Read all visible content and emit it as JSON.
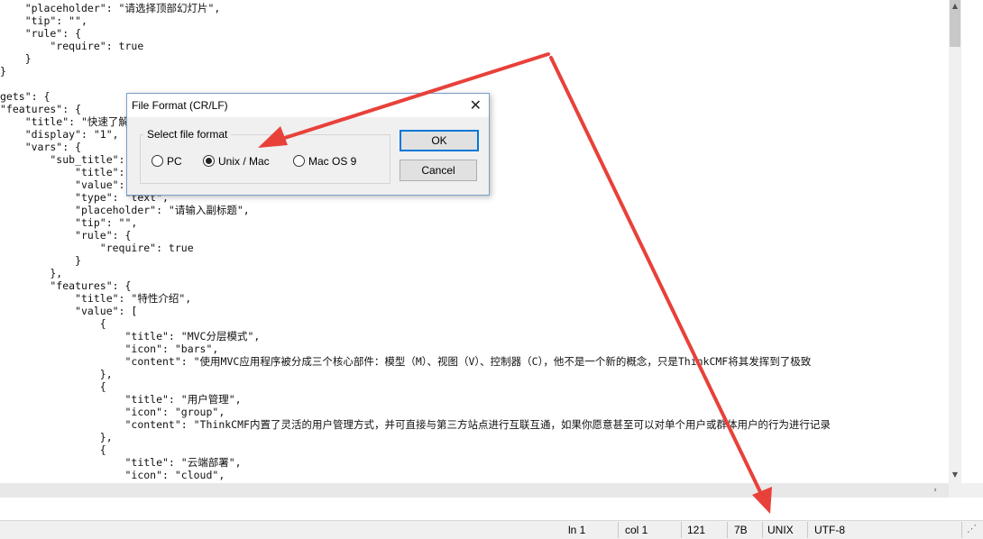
{
  "editor": {
    "lines": [
      "    \"placeholder\": \"请选择顶部幻灯片\",",
      "    \"tip\": \"\",",
      "    \"rule\": {",
      "        \"require\": true",
      "    }",
      "}",
      "",
      "gets\": {",
      "\"features\": {",
      "    \"title\": \"快速了解",
      "    \"display\": \"1\",",
      "    \"vars\": {",
      "        \"sub_title\": {",
      "            \"title\":",
      "            \"value\":",
      "            \"type\": \"text\",",
      "            \"placeholder\": \"请输入副标题\",",
      "            \"tip\": \"\",",
      "            \"rule\": {",
      "                \"require\": true",
      "            }",
      "        },",
      "        \"features\": {",
      "            \"title\": \"特性介绍\",",
      "            \"value\": [",
      "                {",
      "                    \"title\": \"MVC分层模式\",",
      "                    \"icon\": \"bars\",",
      "                    \"content\": \"使用MVC应用程序被分成三个核心部件：模型（M）、视图（V）、控制器（C），他不是一个新的概念，只是ThinkCMF将其发挥到了极致",
      "                },",
      "                {",
      "                    \"title\": \"用户管理\",",
      "                    \"icon\": \"group\",",
      "                    \"content\": \"ThinkCMF内置了灵活的用户管理方式，并可直接与第三方站点进行互联互通，如果你愿意甚至可以对单个用户或群体用户的行为进行记录",
      "                },",
      "                {",
      "                    \"title\": \"云端部署\",",
      "                    \"icon\": \"cloud\","
    ]
  },
  "dialog": {
    "title": "File Format (CR/LF)",
    "close_glyph": "✕",
    "group_label": "Select file format",
    "options": [
      {
        "label": "PC",
        "selected": false
      },
      {
        "label": "Unix / Mac",
        "selected": true
      },
      {
        "label": "Mac OS 9",
        "selected": false
      }
    ],
    "ok_label": "OK",
    "cancel_label": "Cancel"
  },
  "scroll": {
    "up_glyph": "▲",
    "down_glyph": "▼",
    "right_glyph": "›"
  },
  "status": {
    "line": "ln 1",
    "col": "col 1",
    "chars": "121",
    "size": "7B",
    "eol": "UNIX",
    "encoding": "UTF-8",
    "grip_glyph": "⋰"
  },
  "annotation": {
    "arrow_color": "#e8413a",
    "icon": "red-arrow-icon"
  }
}
